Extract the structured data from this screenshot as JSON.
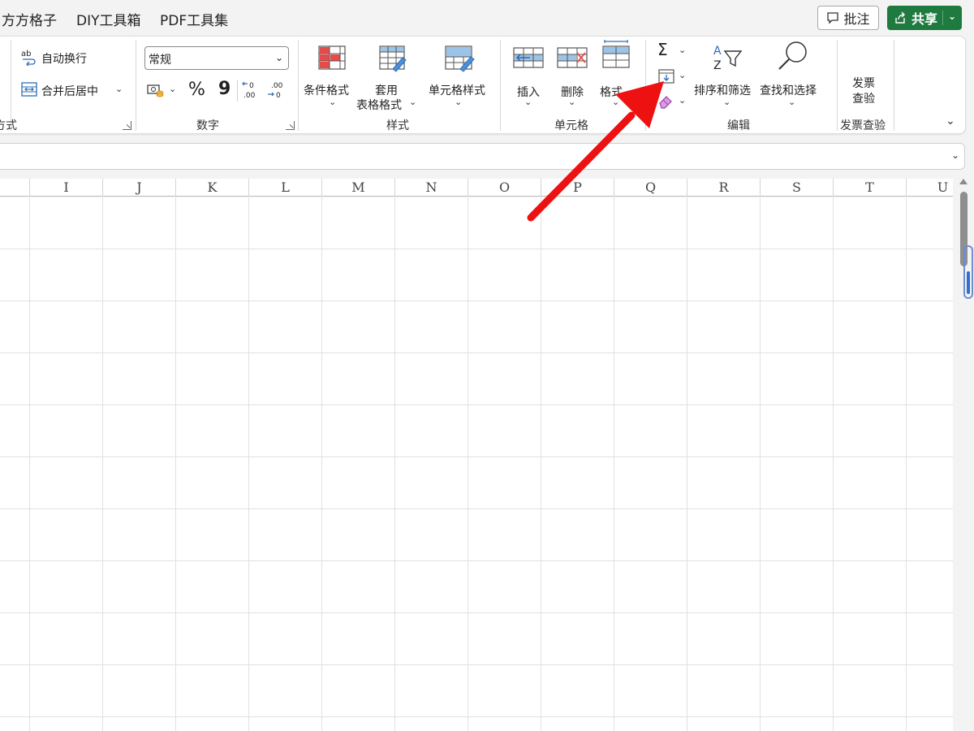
{
  "menubar": {
    "tabs": [
      "方方格子",
      "DIY工具箱",
      "PDF工具集"
    ],
    "comment_label": "批注",
    "share_label": "共享"
  },
  "ribbon": {
    "alignment": {
      "wrap_text": "自动换行",
      "merge_center": "合并后居中",
      "group_label": "方式"
    },
    "number": {
      "format_value": "常规",
      "percent": "%",
      "comma": "9",
      "group_label": "数字"
    },
    "styles": {
      "conditional_format": "条件格式",
      "table_format_line1": "套用",
      "table_format_line2": "表格格式",
      "cell_styles": "单元格样式",
      "group_label": "样式"
    },
    "cells": {
      "insert": "插入",
      "delete": "删除",
      "format": "格式",
      "group_label": "单元格"
    },
    "editing": {
      "autosum_symbol": "Σ",
      "sort_filter": "排序和筛选",
      "find_select": "查找和选择",
      "group_label": "编辑"
    },
    "invoice": {
      "button_line1": "发票",
      "button_line2": "查验",
      "group_label": "发票查验"
    }
  },
  "grid": {
    "columns": [
      "I",
      "J",
      "K",
      "L",
      "M",
      "N",
      "O",
      "P",
      "Q",
      "R",
      "S",
      "T",
      "U"
    ]
  },
  "colors": {
    "share_green": "#1e7a3f",
    "annotation_arrow": "#ee1111"
  },
  "icons": [
    "comment-icon",
    "share-icon",
    "wrap-text-icon",
    "merge-center-icon",
    "currency-icon",
    "increase-decimal-icon",
    "decrease-decimal-icon",
    "conditional-format-icon",
    "table-format-icon",
    "cell-style-icon",
    "insert-cells-icon",
    "delete-cells-icon",
    "format-cells-icon",
    "fill-icon",
    "clear-eraser-icon",
    "sort-filter-icon",
    "find-magnifier-icon"
  ]
}
